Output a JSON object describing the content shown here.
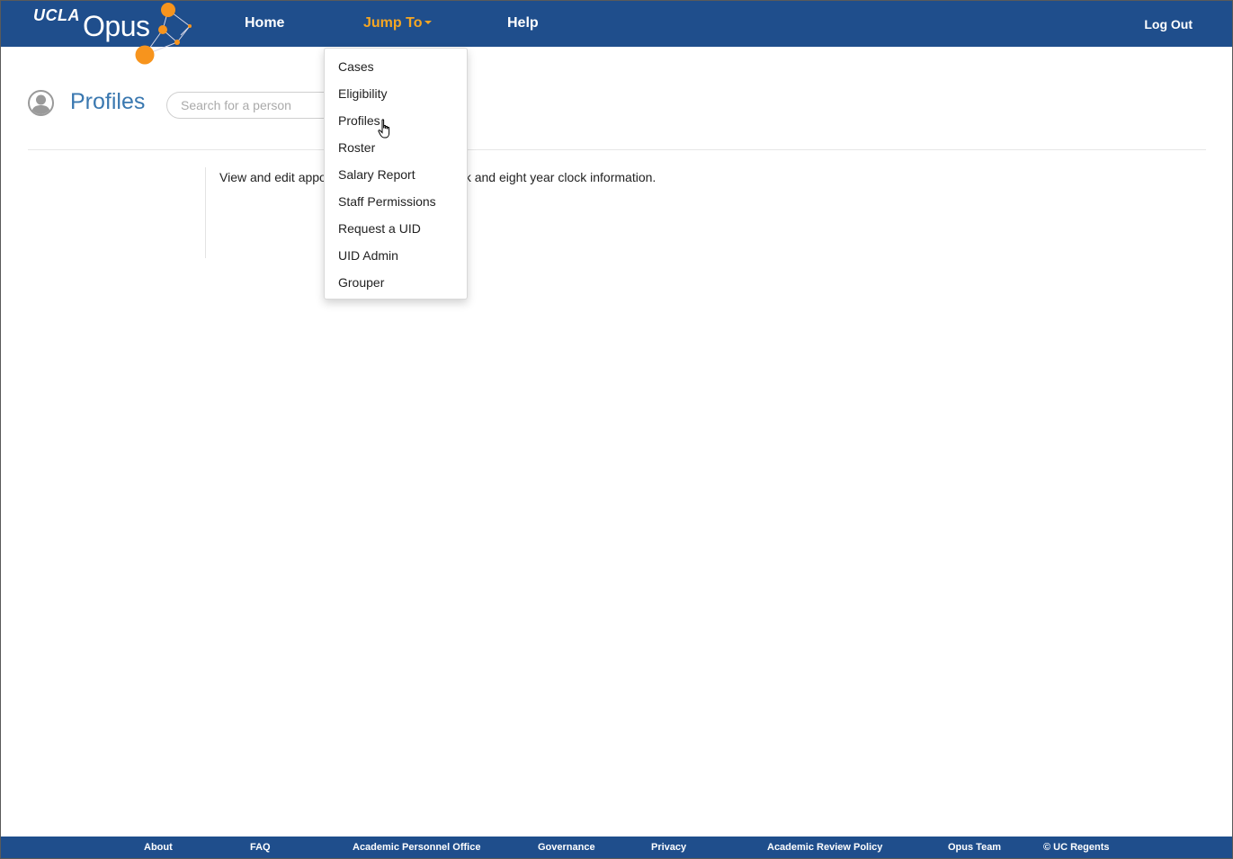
{
  "header": {
    "logo_ucla": "UCLA",
    "logo_opus": "Opus",
    "nav": {
      "home": "Home",
      "jump_to": "Jump To",
      "help": "Help",
      "logout": "Log Out"
    }
  },
  "page": {
    "title": "Profiles",
    "search_placeholder": "Search for a person",
    "description_left": "View and edit appo",
    "description_right": "k and eight year clock information."
  },
  "dropdown": {
    "items": [
      "Cases",
      "Eligibility",
      "Profiles",
      "Roster",
      "Salary Report",
      "Staff Permissions",
      "Request a UID",
      "UID Admin",
      "Grouper"
    ]
  },
  "footer": {
    "links": [
      "About",
      "FAQ",
      "Academic Personnel Office",
      "Governance",
      "Privacy",
      "Academic Review Policy",
      "Opus Team",
      "© UC Regents"
    ]
  },
  "colors": {
    "nav_bg": "#1f4e8c",
    "accent": "#f5a623",
    "title": "#3a78b0"
  }
}
